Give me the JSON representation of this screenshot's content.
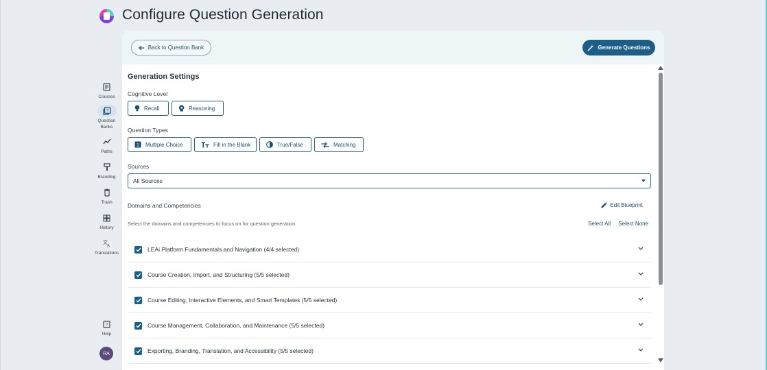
{
  "header": {
    "title": "Configure Question Generation"
  },
  "sidebar": {
    "items": [
      {
        "label": "Courses",
        "icon": "courses-icon"
      },
      {
        "label": "Question Banks",
        "icon": "question-banks-icon",
        "active": true
      },
      {
        "label": "Paths",
        "icon": "paths-icon"
      },
      {
        "label": "Branding",
        "icon": "branding-icon"
      },
      {
        "label": "Trash",
        "icon": "trash-icon"
      },
      {
        "label": "History",
        "icon": "history-icon"
      },
      {
        "label": "Translations",
        "icon": "translations-icon"
      }
    ],
    "help_label": "Help",
    "avatar_initials": "RA"
  },
  "toolbar": {
    "back_label": "Back to Question Bank",
    "generate_label": "Generate Questions"
  },
  "settings": {
    "title": "Generation Settings",
    "cognitive_label": "Cognitive Level",
    "cognitive_options": [
      "Recall",
      "Reasoning"
    ],
    "types_label": "Question Types",
    "type_options": [
      "Multiple Choice",
      "Fill in the Blank",
      "True/False",
      "Matching"
    ],
    "sources_label": "Sources",
    "sources_value": "All Sources",
    "domains_label": "Domains and Competencies",
    "edit_blueprint": "Edit Blueprint",
    "helper": "Select the domains and competencies to focus on for question generation.",
    "select_all": "Select All",
    "select_none": "Select None",
    "domains": [
      "LEAi Platform Fundamentals and Navigation (4/4 selected)",
      "Course Creation, Import, and Structuring (5/5 selected)",
      "Course Editing, Interactive Elements, and Smart Templates (5/5 selected)",
      "Course Management, Collaboration, and Maintenance (5/5 selected)",
      "Exporting, Branding, Translation, and Accessibility (5/5 selected)"
    ]
  },
  "colors": {
    "accent": "#1c5e87",
    "background": "#e9edf1",
    "card_top": "#eef5f6"
  }
}
